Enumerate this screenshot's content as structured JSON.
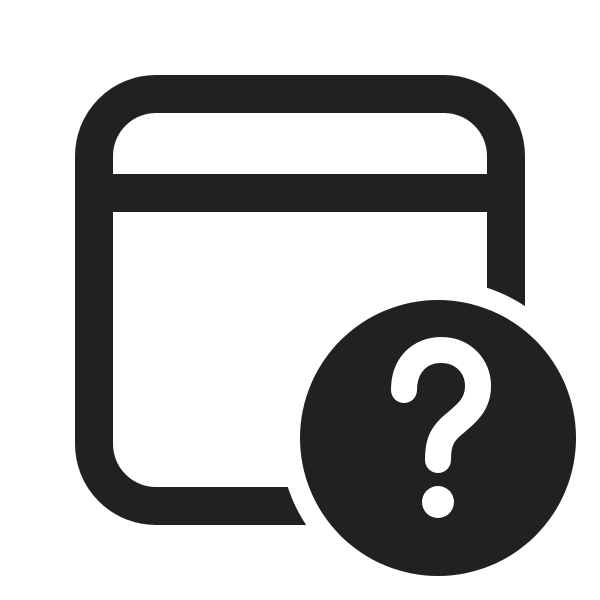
{
  "icon": {
    "name": "window-help-icon",
    "parts": [
      "window-frame-icon",
      "question-badge-icon"
    ]
  },
  "colors": {
    "background": "#ffffff",
    "foreground": "#212121",
    "badge_glyph": "#ffffff"
  }
}
